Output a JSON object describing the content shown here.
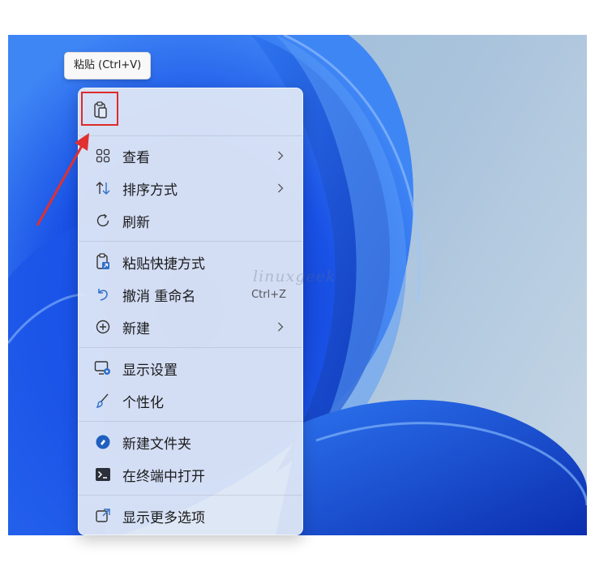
{
  "tooltip": {
    "text": "粘贴 (Ctrl+V)"
  },
  "quick_actions": [
    {
      "name": "paste",
      "icon": "clipboard-icon"
    }
  ],
  "menu": {
    "items": [
      {
        "label": "查看",
        "icon": "grid-icon",
        "submenu": true
      },
      {
        "label": "排序方式",
        "icon": "sort-arrows-icon",
        "submenu": true
      },
      {
        "label": "刷新",
        "icon": "refresh-icon",
        "submenu": false
      },
      {
        "label": "粘贴快捷方式",
        "icon": "paste-shortcut-icon",
        "submenu": false
      },
      {
        "label": "撤消 重命名",
        "icon": "undo-icon",
        "shortcut": "Ctrl+Z",
        "submenu": false
      },
      {
        "label": "新建",
        "icon": "plus-circle-icon",
        "submenu": true
      },
      {
        "label": "显示设置",
        "icon": "display-settings-icon",
        "submenu": false
      },
      {
        "label": "个性化",
        "icon": "brush-icon",
        "submenu": false
      },
      {
        "label": "新建文件夹",
        "icon": "new-folder-icon",
        "submenu": false
      },
      {
        "label": "在终端中打开",
        "icon": "terminal-icon",
        "submenu": false
      },
      {
        "label": "显示更多选项",
        "icon": "more-options-icon",
        "submenu": false
      }
    ]
  },
  "watermark": "linuxgeek",
  "colors": {
    "highlight": "#e02a2a",
    "accent": "#2f6fc8",
    "menu_bg": "#e2eaf6"
  }
}
